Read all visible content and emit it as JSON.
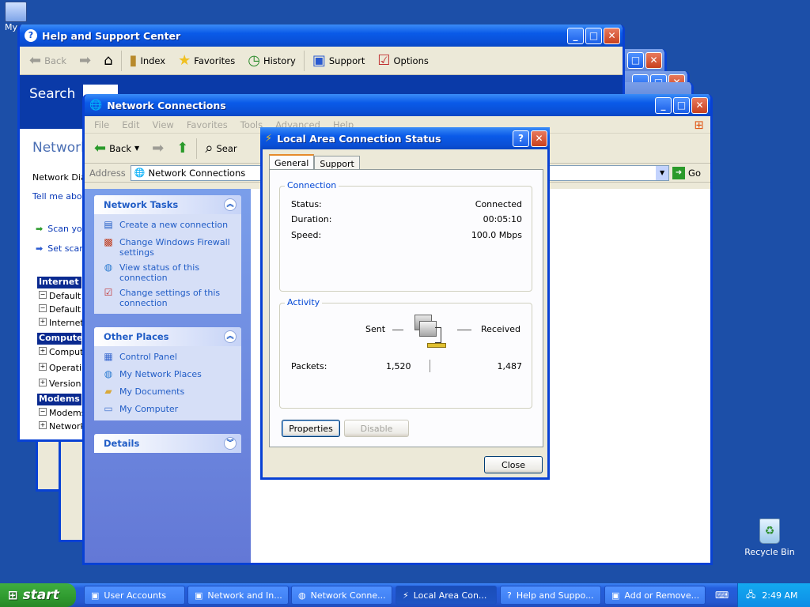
{
  "desktop": {
    "my_computer_label": "My",
    "recycle_bin_label": "Recycle Bin"
  },
  "help_window": {
    "title": "Help and Support Center",
    "toolbar": [
      "Back",
      "Index",
      "Favorites",
      "History",
      "Support",
      "Options"
    ],
    "search_label": "Search",
    "heading": "Network",
    "items": [
      "Network Diag",
      "Tell me about",
      "Scan yo",
      "Set scan"
    ],
    "tree_headers": [
      "Internet S",
      "Computer",
      "Modems a"
    ],
    "tree_items": [
      "Default C",
      "Default C",
      "Internet",
      "Compute",
      "Operatin",
      "Version",
      "Modems",
      "Network"
    ]
  },
  "netconn": {
    "title": "Network Connections",
    "menu": [
      "File",
      "Edit",
      "View",
      "Favorites",
      "Tools",
      "Advanced",
      "Help"
    ],
    "back_label": "Back",
    "search_label": "Sear",
    "address_label": "Address",
    "address_value": "Network Connections",
    "go_label": "Go",
    "network_tasks": {
      "title": "Network Tasks",
      "items": [
        "Create a new connection",
        "Change Windows Firewall settings",
        "View status of this connection",
        "Change settings of this connection"
      ]
    },
    "other_places": {
      "title": "Other Places",
      "items": [
        "Control Panel",
        "My Network Places",
        "My Documents",
        "My Computer"
      ]
    },
    "details": {
      "title": "Details"
    }
  },
  "dialog": {
    "title": "Local Area Connection Status",
    "tabs": [
      "General",
      "Support"
    ],
    "connection_group": "Connection",
    "status_label": "Status:",
    "status_value": "Connected",
    "duration_label": "Duration:",
    "duration_value": "00:05:10",
    "speed_label": "Speed:",
    "speed_value": "100.0 Mbps",
    "activity_group": "Activity",
    "sent_label": "Sent",
    "received_label": "Received",
    "packets_label": "Packets:",
    "packets_sent": "1,520",
    "packets_received": "1,487",
    "properties_button": "Properties",
    "disable_button": "Disable",
    "close_button": "Close"
  },
  "taskbar": {
    "start_label": "start",
    "items": [
      "User Accounts",
      "Network and In...",
      "Network Conne...",
      "Local Area Con...",
      "Help and Suppo...",
      "Add or Remove..."
    ],
    "clock": "2:49 AM"
  }
}
